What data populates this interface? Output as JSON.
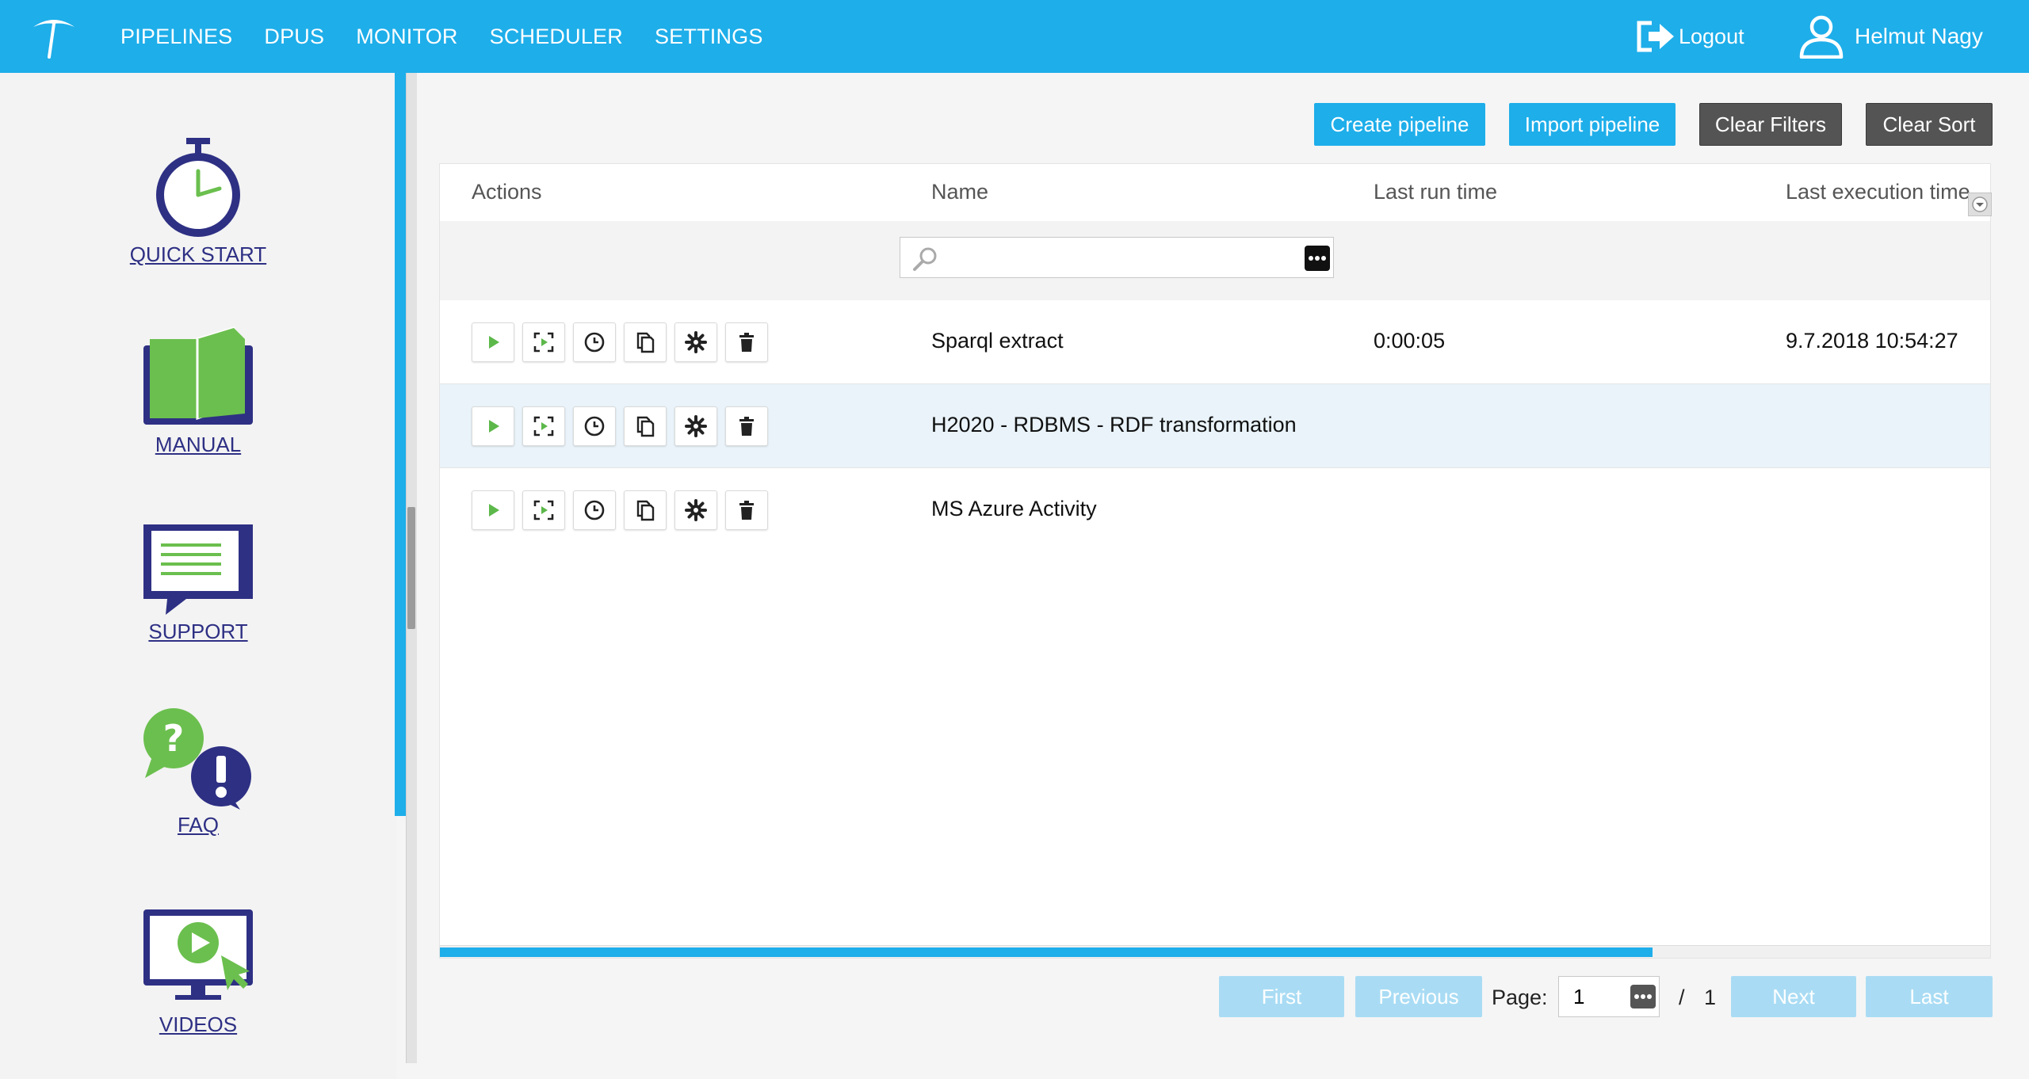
{
  "nav": {
    "items": [
      "PIPELINES",
      "DPUS",
      "MONITOR",
      "SCHEDULER",
      "SETTINGS"
    ],
    "logout_label": "Logout",
    "user_name": "Helmut Nagy"
  },
  "sidebar": {
    "items": [
      {
        "label": "QUICK START",
        "icon": "stopwatch-icon"
      },
      {
        "label": "MANUAL",
        "icon": "book-icon"
      },
      {
        "label": "SUPPORT",
        "icon": "chat-bubble-icon"
      },
      {
        "label": "FAQ",
        "icon": "question-exclamation-icon"
      },
      {
        "label": "VIDEOS",
        "icon": "monitor-play-icon"
      }
    ]
  },
  "toolbar": {
    "create_label": "Create pipeline",
    "import_label": "Import pipeline",
    "clear_filters_label": "Clear Filters",
    "clear_sort_label": "Clear Sort"
  },
  "table": {
    "columns": [
      "Actions",
      "Name",
      "Last run time",
      "Last execution time"
    ],
    "search_placeholder": "",
    "rows": [
      {
        "name": "Sparql extract",
        "last_run_time": "0:00:05",
        "last_execution_time": "9.7.2018 10:54:27"
      },
      {
        "name": "H2020 - RDBMS - RDF transformation",
        "last_run_time": "",
        "last_execution_time": ""
      },
      {
        "name": "MS Azure Activity",
        "last_run_time": "",
        "last_execution_time": ""
      }
    ]
  },
  "pager": {
    "first_label": "First",
    "previous_label": "Previous",
    "page_label": "Page:",
    "current_page": "1",
    "separator": "/",
    "total_pages": "1",
    "next_label": "Next",
    "last_label": "Last"
  },
  "colors": {
    "accent": "#1eaeea",
    "brand_navy": "#2e3084",
    "brand_green": "#6bbf4e",
    "dark_button": "#545454"
  }
}
